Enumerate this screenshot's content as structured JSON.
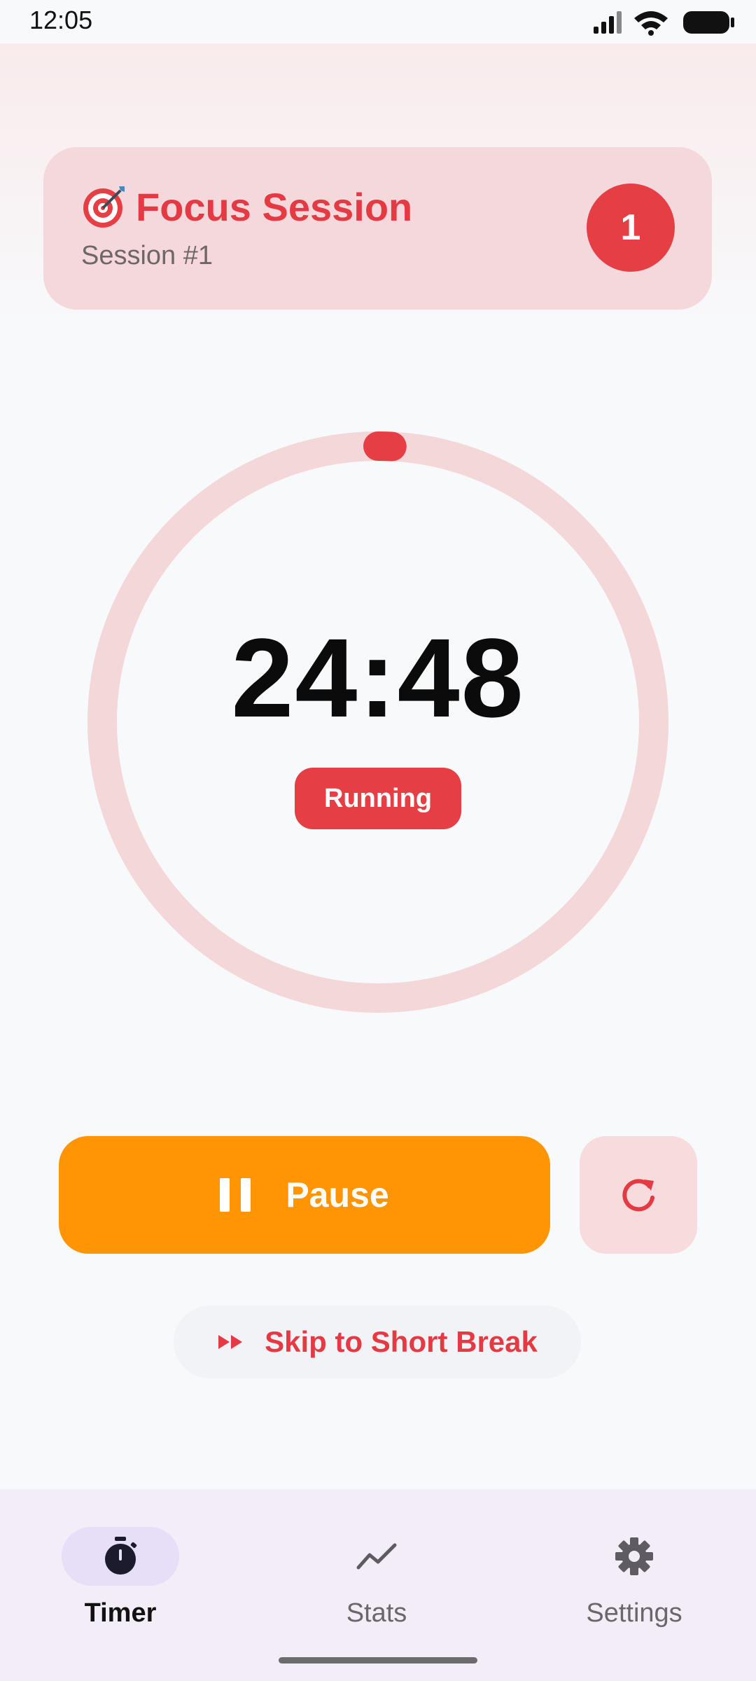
{
  "status_bar": {
    "time": "12:05"
  },
  "session_card": {
    "title": "Focus Session",
    "subtitle": "Session #1",
    "badge": "1"
  },
  "timer": {
    "time": "24:48",
    "state": "Running",
    "progress": 0.008
  },
  "controls": {
    "pause_label": "Pause",
    "skip_label": "Skip to Short Break"
  },
  "bottom_nav": {
    "items": [
      {
        "label": "Timer",
        "icon": "stopwatch-icon",
        "active": true
      },
      {
        "label": "Stats",
        "icon": "trend-line-icon",
        "active": false
      },
      {
        "label": "Settings",
        "icon": "gear-icon",
        "active": false
      }
    ]
  },
  "colors": {
    "accent_red": "#E63E45",
    "pause_orange": "#FF9405",
    "ring_track": "#F4D7D9",
    "nav_active_pill": "#E7DEF8"
  }
}
